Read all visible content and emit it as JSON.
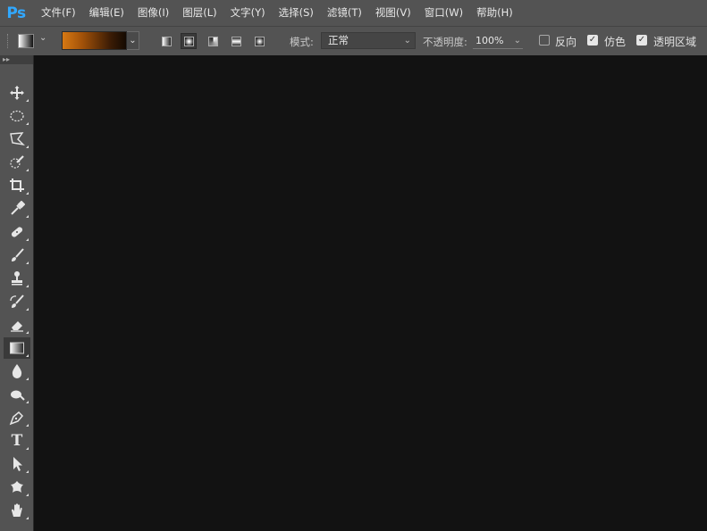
{
  "app": {
    "logo": "Ps"
  },
  "menu": [
    "文件(F)",
    "编辑(E)",
    "图像(I)",
    "图层(L)",
    "文字(Y)",
    "选择(S)",
    "滤镜(T)",
    "视图(V)",
    "窗口(W)",
    "帮助(H)"
  ],
  "options": {
    "gradient_colors": [
      "#d77913",
      "#a45309",
      "#3c1c05",
      "#140a02"
    ],
    "gradient_types": [
      "linear-gradient-icon",
      "radial-gradient-icon",
      "angle-gradient-icon",
      "reflected-gradient-icon",
      "diamond-gradient-icon"
    ],
    "selected_gradient_type": "radial-gradient-icon",
    "mode_label": "模式:",
    "mode_value": "正常",
    "opacity_label": "不透明度:",
    "opacity_value": "100%",
    "reverse_label": "反向",
    "reverse_checked": false,
    "dither_label": "仿色",
    "dither_checked": true,
    "transparency_label": "透明区域",
    "transparency_checked": true
  },
  "toolbox": {
    "tools": [
      "move-tool-icon",
      "ellipse-marquee-icon",
      "polygonal-lasso-icon",
      "quick-selection-icon",
      "crop-icon",
      "eyedropper-icon",
      "healing-brush-icon",
      "brush-icon",
      "clone-stamp-icon",
      "history-brush-icon",
      "eraser-icon",
      "gradient-tool-icon",
      "blur-icon",
      "dodge-icon",
      "pen-icon",
      "type-icon",
      "path-selection-icon",
      "custom-shape-icon",
      "hand-icon"
    ],
    "active": "gradient-tool-icon",
    "type_glyph": "T"
  }
}
